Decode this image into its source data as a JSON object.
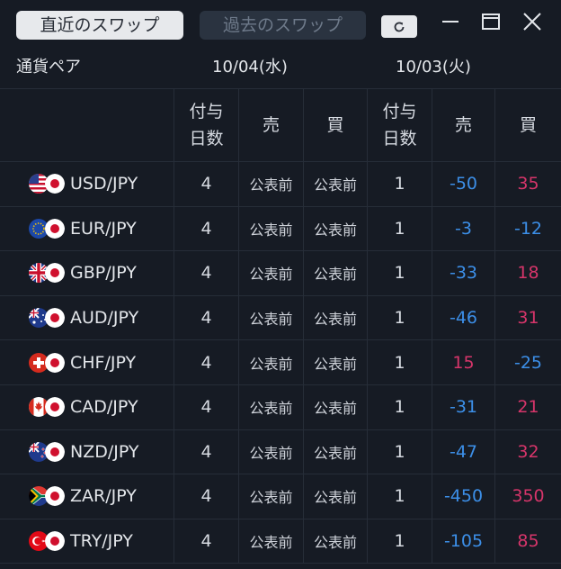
{
  "tabs": {
    "recent": "直近のスワップ",
    "past": "過去のスワップ"
  },
  "header": {
    "pair_label": "通貨ペア",
    "date1": "10/04(水)",
    "date2": "10/03(火)"
  },
  "columns": {
    "days_line1": "付与",
    "days_line2": "日数",
    "sell": "売",
    "buy": "買"
  },
  "colors": {
    "negative": "#3c8fe8",
    "positive": "#d6356a"
  },
  "rows": [
    {
      "pair": "USD/JPY",
      "flag": "us",
      "d1_days": "4",
      "d1_sell": "公表前",
      "d1_buy": "公表前",
      "d2_days": "1",
      "d2_sell": "-50",
      "d2_buy": "35"
    },
    {
      "pair": "EUR/JPY",
      "flag": "eu",
      "d1_days": "4",
      "d1_sell": "公表前",
      "d1_buy": "公表前",
      "d2_days": "1",
      "d2_sell": "-3",
      "d2_buy": "-12"
    },
    {
      "pair": "GBP/JPY",
      "flag": "gb",
      "d1_days": "4",
      "d1_sell": "公表前",
      "d1_buy": "公表前",
      "d2_days": "1",
      "d2_sell": "-33",
      "d2_buy": "18"
    },
    {
      "pair": "AUD/JPY",
      "flag": "au",
      "d1_days": "4",
      "d1_sell": "公表前",
      "d1_buy": "公表前",
      "d2_days": "1",
      "d2_sell": "-46",
      "d2_buy": "31"
    },
    {
      "pair": "CHF/JPY",
      "flag": "ch",
      "d1_days": "4",
      "d1_sell": "公表前",
      "d1_buy": "公表前",
      "d2_days": "1",
      "d2_sell": "15",
      "d2_buy": "-25"
    },
    {
      "pair": "CAD/JPY",
      "flag": "ca",
      "d1_days": "4",
      "d1_sell": "公表前",
      "d1_buy": "公表前",
      "d2_days": "1",
      "d2_sell": "-31",
      "d2_buy": "21"
    },
    {
      "pair": "NZD/JPY",
      "flag": "nz",
      "d1_days": "4",
      "d1_sell": "公表前",
      "d1_buy": "公表前",
      "d2_days": "1",
      "d2_sell": "-47",
      "d2_buy": "32"
    },
    {
      "pair": "ZAR/JPY",
      "flag": "za",
      "d1_days": "4",
      "d1_sell": "公表前",
      "d1_buy": "公表前",
      "d2_days": "1",
      "d2_sell": "-450",
      "d2_buy": "350"
    },
    {
      "pair": "TRY/JPY",
      "flag": "tr",
      "d1_days": "4",
      "d1_sell": "公表前",
      "d1_buy": "公表前",
      "d2_days": "1",
      "d2_sell": "-105",
      "d2_buy": "85"
    }
  ]
}
